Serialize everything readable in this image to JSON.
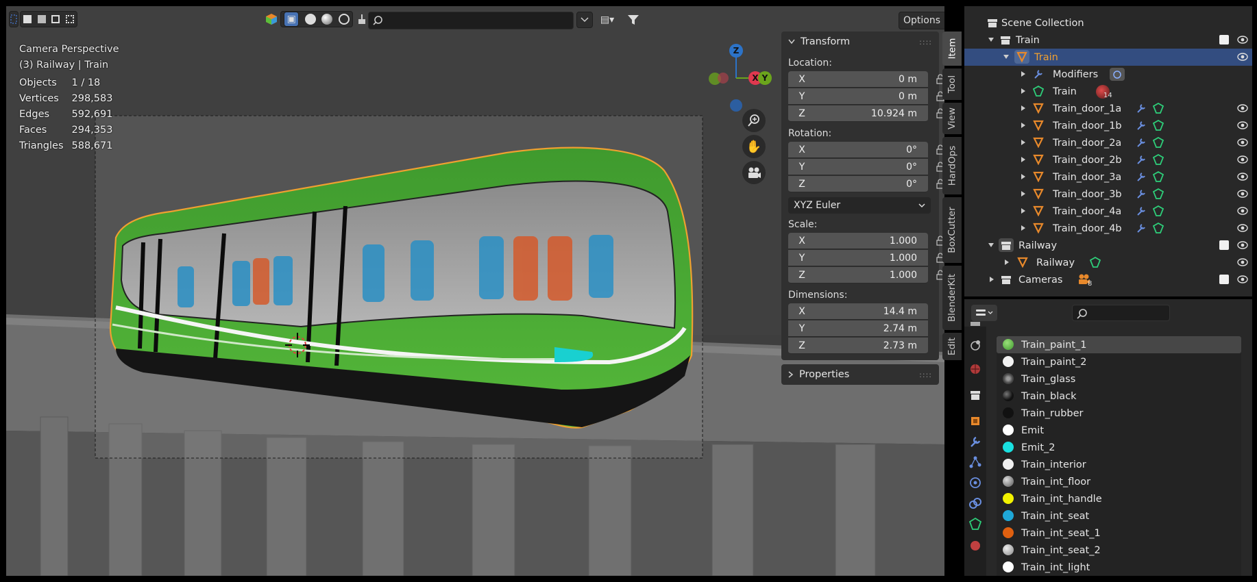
{
  "viewport": {
    "header": {
      "options_label": "Options",
      "search_placeholder": ""
    },
    "overlay": {
      "view_name": "Camera Perspective",
      "context": "(3) Railway | Train",
      "stats": [
        {
          "label": "Objects",
          "value": "1 / 18"
        },
        {
          "label": "Vertices",
          "value": "298,583"
        },
        {
          "label": "Edges",
          "value": "592,691"
        },
        {
          "label": "Faces",
          "value": "294,353"
        },
        {
          "label": "Triangles",
          "value": "588,671"
        }
      ]
    },
    "gizmo": {
      "z": "Z",
      "x": "X",
      "y": "Y"
    }
  },
  "npanel": {
    "transform_title": "Transform",
    "location_label": "Location:",
    "location": [
      {
        "axis": "X",
        "value": "0 m"
      },
      {
        "axis": "Y",
        "value": "0 m"
      },
      {
        "axis": "Z",
        "value": "10.924 m"
      }
    ],
    "rotation_label": "Rotation:",
    "rotation": [
      {
        "axis": "X",
        "value": "0°"
      },
      {
        "axis": "Y",
        "value": "0°"
      },
      {
        "axis": "Z",
        "value": "0°"
      }
    ],
    "rotation_mode": "XYZ Euler",
    "scale_label": "Scale:",
    "scale": [
      {
        "axis": "X",
        "value": "1.000"
      },
      {
        "axis": "Y",
        "value": "1.000"
      },
      {
        "axis": "Z",
        "value": "1.000"
      }
    ],
    "dimensions_label": "Dimensions:",
    "dimensions": [
      {
        "axis": "X",
        "value": "14.4 m"
      },
      {
        "axis": "Y",
        "value": "2.74 m"
      },
      {
        "axis": "Z",
        "value": "2.73 m"
      }
    ],
    "properties_title": "Properties",
    "tabs": [
      "Item",
      "Tool",
      "View",
      "HardOps",
      "BoxCutter",
      "BlenderKit",
      "Edit"
    ]
  },
  "outliner": {
    "scene_collection": "Scene Collection",
    "rows": [
      {
        "label": "Train",
        "kind": "collection"
      },
      {
        "label": "Train",
        "kind": "object"
      },
      {
        "label": "Modifiers",
        "kind": "modifiers"
      },
      {
        "label": "Train",
        "kind": "mesh",
        "badge": "14"
      },
      {
        "label": "Train_door_1a",
        "kind": "object"
      },
      {
        "label": "Train_door_1b",
        "kind": "object"
      },
      {
        "label": "Train_door_2a",
        "kind": "object"
      },
      {
        "label": "Train_door_2b",
        "kind": "object"
      },
      {
        "label": "Train_door_3a",
        "kind": "object"
      },
      {
        "label": "Train_door_3b",
        "kind": "object"
      },
      {
        "label": "Train_door_4a",
        "kind": "object"
      },
      {
        "label": "Train_door_4b",
        "kind": "object"
      },
      {
        "label": "Railway",
        "kind": "collection"
      },
      {
        "label": "Railway",
        "kind": "object"
      },
      {
        "label": "Cameras",
        "kind": "collection",
        "badge": "8"
      }
    ]
  },
  "materials": {
    "search_placeholder": "",
    "items": [
      {
        "name": "Train_paint_1",
        "color": "#5bbf3a"
      },
      {
        "name": "Train_paint_2",
        "color": "#f2f2f2"
      },
      {
        "name": "Train_glass",
        "color": "#6a6a6a"
      },
      {
        "name": "Train_black",
        "color": "#202020"
      },
      {
        "name": "Train_rubber",
        "color": "#111111"
      },
      {
        "name": "Emit",
        "color": "#ffffff"
      },
      {
        "name": "Emit_2",
        "color": "#19e0e0"
      },
      {
        "name": "Train_interior",
        "color": "#f0f0f0"
      },
      {
        "name": "Train_int_floor",
        "color": "#9a9a9a"
      },
      {
        "name": "Train_int_handle",
        "color": "#f2f200"
      },
      {
        "name": "Train_int_seat",
        "color": "#1fa8d8"
      },
      {
        "name": "Train_int_seat_1",
        "color": "#e06010"
      },
      {
        "name": "Train_int_seat_2",
        "color": "#bdbdbd"
      },
      {
        "name": "Train_int_light",
        "color": "#ffffff"
      }
    ]
  },
  "colors": {
    "accent": "#4772b3",
    "selected_row": "#334d80",
    "object_orange": "#e8892b",
    "mesh_green": "#2ecf7a",
    "modifier_blue": "#6a8fe0"
  }
}
